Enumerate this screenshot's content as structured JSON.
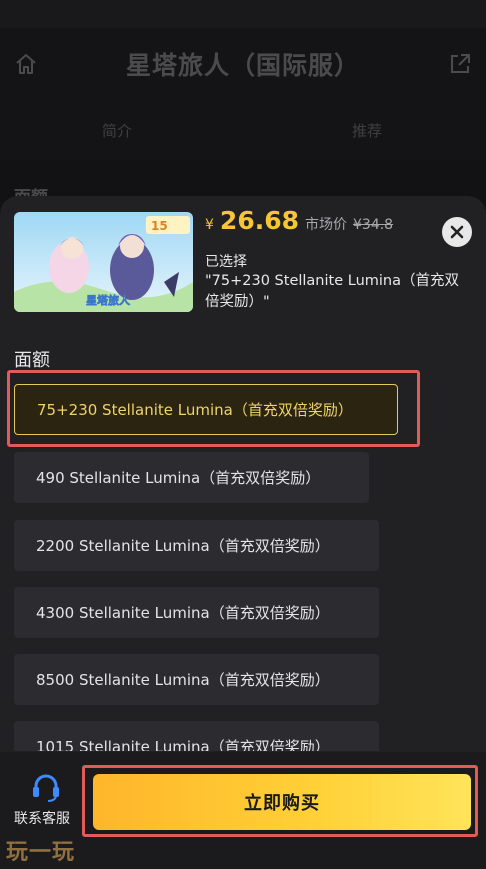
{
  "background_page": {
    "title": "星塔旅人（国际服）",
    "tabs": [
      "简介",
      "推荐"
    ],
    "section_label": "面额",
    "icons": [
      "home-icon",
      "share-icon"
    ]
  },
  "sheet": {
    "currency_symbol": "¥",
    "price": "26.68",
    "market_price_label": "市场价",
    "market_price": "¥34.8",
    "selected_label": "已选择",
    "selected_value": "\"75+230 Stellanite Lumina（首充双倍奖励）\"",
    "product_image_caption": "15",
    "section_title": "面额",
    "options": [
      {
        "label": "75+230 Stellanite Lumina（首充双倍奖励）",
        "selected": true
      },
      {
        "label": "490 Stellanite Lumina（首充双倍奖励）",
        "selected": false
      },
      {
        "label": "2200 Stellanite Lumina（首充双倍奖励）",
        "selected": false
      },
      {
        "label": "4300 Stellanite Lumina（首充双倍奖励）",
        "selected": false
      },
      {
        "label": "8500 Stellanite Lumina（首充双倍奖励）",
        "selected": false
      },
      {
        "label": "1015 Stellanite Lumina（首充双倍奖励）",
        "selected": false
      }
    ]
  },
  "footer": {
    "customer_service_label": "联系客服",
    "buy_button_label": "立即购买"
  },
  "watermark": "玩一玩",
  "colors": {
    "accent": "#f6c637",
    "highlight": "#e25b5b",
    "sheet_bg": "#212124"
  }
}
